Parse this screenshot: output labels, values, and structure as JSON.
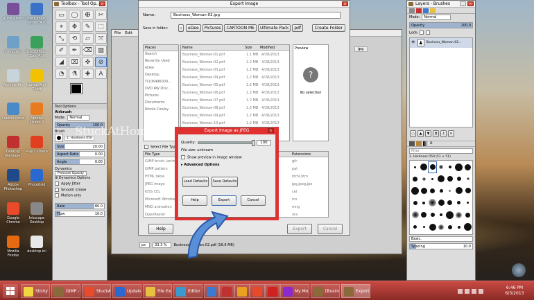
{
  "desktop": {
    "icons": [
      {
        "label": "aOne Alarm",
        "color": "#7a4f9a"
      },
      {
        "label": "OpenOffice... Writer 4.0",
        "color": "#3a72c8"
      },
      {
        "label": "Computer",
        "color": "#6fa0c8"
      },
      {
        "label": "OpenOffice... Calc 4.0",
        "color": "#3aa05a"
      },
      {
        "label": "Recycle Bin",
        "color": "#c8d4dc"
      },
      {
        "label": "Norton Anti-Theft",
        "color": "#f2c200"
      },
      {
        "label": "Control Panel",
        "color": "#4a8ac8"
      },
      {
        "label": "Aptana Studio 3",
        "color": "#e87a20"
      },
      {
        "label": "Desktop Wallpaper",
        "color": "#c03030"
      },
      {
        "label": "Play Camera",
        "color": "#e04020"
      },
      {
        "label": "Adobe Photoshop",
        "color": "#1e4a8a"
      },
      {
        "label": "PhotoGrid",
        "color": "#2a6ad0"
      },
      {
        "label": "Google Chrome",
        "color": "#e84a2a"
      },
      {
        "label": "Inkscape Desktop",
        "color": "#888888"
      },
      {
        "label": "Mozilla Firefox",
        "color": "#e86a10"
      },
      {
        "label": "desktop.ini",
        "color": "#e8e8e8"
      }
    ]
  },
  "toolbox": {
    "title": "Toolbox - Tool Op...",
    "tools": [
      "▭",
      "◯",
      "ⴲ",
      "✂",
      "⌖",
      "✥",
      "✎",
      "⬚",
      "⤡",
      "⟲",
      "▱",
      "⤧",
      "✐",
      "✒",
      "⌫",
      "▨",
      "◢",
      "⌧",
      "✜",
      "⊘",
      "◔",
      "⚗",
      "✚",
      "A"
    ],
    "tool_options": {
      "header": "Tool Options",
      "mode_label": "Airbrush",
      "mode": "Mode:",
      "mode_value": "Normal",
      "opacity_label": "Opacity",
      "opacity_value": "100.0",
      "brush_label": "Brush",
      "brush_value": "2. Hardness 050",
      "size_label": "Size",
      "size_value": "20.00",
      "aspect_label": "Aspect Ratio",
      "aspect_value": "0.00",
      "angle_label": "Angle",
      "angle_value": "0.00",
      "dynamics_label": "Dynamics",
      "dynamics_value": "Pressure Opacity",
      "dynamics_options": "Dynamics Options",
      "apply_jitter": "Apply Jitter",
      "smooth_stroke": "Smooth stroke",
      "motion_only": "Motion only",
      "rate_label": "Rate",
      "rate_value": "80.0",
      "flow_label": "Flow",
      "flow_value": "10.0"
    }
  },
  "gimp_main": {
    "menu": [
      "File",
      "Edit"
    ],
    "tab_label": "jpg",
    "status_unit": "px",
    "status_zoom": "33.3 %",
    "status_file": "Business_Woman-02.pdf (16.6 MB)"
  },
  "export_dialog": {
    "title": "Export Image",
    "name_label": "Name:",
    "name_value": "Business_Woman-02.jpg",
    "save_in_label": "Save in folder:",
    "breadcrumbs": [
      "eDee",
      "Pictures",
      "CARTOON ME",
      "Ultimate Pack",
      "pdf"
    ],
    "create_folder": "Create Folder",
    "places_header": "Places",
    "places": [
      "Search",
      "Recently Used",
      "eDee",
      "Desktop",
      "TI106496000...",
      "DVD RW Driv...",
      "Pictures",
      "Documents",
      "Nicole Cooley"
    ],
    "col_name": "Name",
    "col_size": "Size",
    "col_modified": "Modified",
    "files": [
      {
        "name": "Business_Woman-01.pdf",
        "size": "1.1 MB",
        "modified": "4/28/2013"
      },
      {
        "name": "Business_Woman-02.pdf",
        "size": "1.2 MB",
        "modified": "4/28/2013"
      },
      {
        "name": "Business_Woman-03.pdf",
        "size": "1.2 MB",
        "modified": "4/28/2013"
      },
      {
        "name": "Business_Woman-04.pdf",
        "size": "1.2 MB",
        "modified": "4/28/2013"
      },
      {
        "name": "Business_Woman-05.pdf",
        "size": "1.2 MB",
        "modified": "4/28/2013"
      },
      {
        "name": "Business_Woman-06.pdf",
        "size": "1.2 MB",
        "modified": "4/28/2013"
      },
      {
        "name": "Business_Woman-07.pdf",
        "size": "1.2 MB",
        "modified": "4/28/2013"
      },
      {
        "name": "Business_Woman-08.pdf",
        "size": "1.2 MB",
        "modified": "4/28/2013"
      },
      {
        "name": "Business_Woman-09.pdf",
        "size": "1.2 MB",
        "modified": "4/28/2013"
      },
      {
        "name": "Business_Woman-10.pdf",
        "size": "1.2 MB",
        "modified": "4/28/2013"
      }
    ],
    "preview_header": "Preview",
    "no_selection": "No selection",
    "select_file_type": "Select File Type",
    "file_type_header": "File Type",
    "extensions_header": "Extensions",
    "file_types": [
      {
        "type": "GIMP brush (anim...",
        "ext": "gih"
      },
      {
        "type": "GIMP pattern",
        "ext": "pat"
      },
      {
        "type": "HTML table",
        "ext": "html,htm"
      },
      {
        "type": "JPEG image",
        "ext": "jpg,jpeg,jpe"
      },
      {
        "type": "KISS CEL",
        "ext": "cel"
      },
      {
        "type": "Microsoft Window...",
        "ext": "ico"
      },
      {
        "type": "MNG animation",
        "ext": "mng"
      },
      {
        "type": "OpenRaster",
        "ext": "ora"
      }
    ],
    "help": "Help",
    "export": "Export",
    "cancel": "Cancel"
  },
  "jpeg_dialog": {
    "title": "Export Image as JPEG",
    "quality_label": "Quality:",
    "quality_value": "100",
    "quality_level": 1.0,
    "file_size": "File size: unknown",
    "show_preview": "Show preview in image window",
    "advanced": "Advanced Options",
    "load_defaults": "Load Defaults",
    "save_defaults": "Save Defaults",
    "help": "Help",
    "export": "Export",
    "cancel": "Cancel",
    "highlight_color": "#e03030"
  },
  "watermark": "StuckAtHomeMom.com",
  "layers": {
    "title": "Layers - Brushes",
    "mode_label": "Mode:",
    "mode_value": "Normal",
    "opacity_label": "Opacity",
    "opacity_value": "100.0",
    "lock_label": "Lock:",
    "layer_name": "Business_Woman-02...",
    "filter_label": "filter",
    "brush_name": "2. Hardness 050 (51 × 51)",
    "basic_label": "Basic.",
    "spacing_label": "Spacing",
    "spacing_value": "10.0"
  },
  "taskbar": {
    "items": [
      {
        "label": "Sticky N...",
        "color": "#f2d640"
      },
      {
        "label": "GIMP - ...",
        "color": "#8a6a3a"
      },
      {
        "label": "StuckAt...",
        "color": "#e84a2a"
      },
      {
        "label": "Update |...",
        "color": "#2a6ad0"
      },
      {
        "label": "File Expl...",
        "color": "#e8c040"
      },
      {
        "label": "Editor - ...",
        "color": "#3a9ad0"
      },
      {
        "label": "",
        "color": "#3a7ad0"
      },
      {
        "label": "",
        "color": "#c03030"
      },
      {
        "label": "",
        "color": "#e8a020"
      },
      {
        "label": "",
        "color": "#e84a2a"
      },
      {
        "label": "",
        "color": "#d02020"
      },
      {
        "label": "My Mov...",
        "color": "#8a2ad0"
      },
      {
        "label": "[Busines...",
        "color": "#8a6a3a"
      },
      {
        "label": "Export I...",
        "color": "#8a6a3a"
      }
    ],
    "time": "6:46 PM",
    "date": "6/3/2013"
  }
}
